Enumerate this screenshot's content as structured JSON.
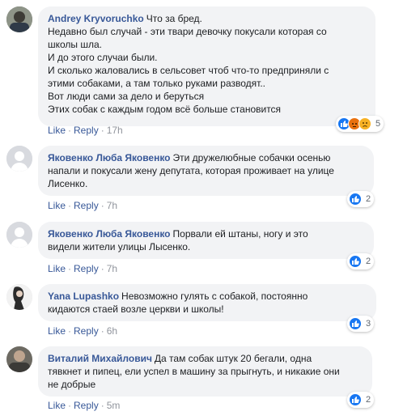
{
  "comments": [
    {
      "author": "Andrey Kryvoruchko",
      "lines": [
        "Что за бред.",
        "Недавно был случай - эти твари девочку покусали которая со",
        "школы шла.",
        "И до этого случаи были.",
        "И сколько жаловались в сельсовет чтоб что-то предприняли с",
        "этими собаками, а там только руками разводят..",
        "Вот люди сами за дело и беруться",
        "Этих собак с каждым годом всё больше становится"
      ],
      "like": "Like",
      "reply": "Reply",
      "time": "17h",
      "reactions": [
        "like-icon",
        "angry-icon",
        "sad-icon"
      ],
      "reaction_count": "5"
    },
    {
      "author": "Яковенко Люба Яковенко",
      "lines": [
        "Эти дружелюбные собачки осенью",
        "напали и покусали жену депутата, которая проживает на улице",
        "Лисенко."
      ],
      "like": "Like",
      "reply": "Reply",
      "time": "7h",
      "reactions": [
        "like-icon"
      ],
      "reaction_count": "2"
    },
    {
      "author": "Яковенко Люба Яковенко",
      "lines": [
        "Порвали ей штаны, ногу и это",
        "видели жители улицы Лысенко."
      ],
      "like": "Like",
      "reply": "Reply",
      "time": "7h",
      "reactions": [
        "like-icon"
      ],
      "reaction_count": "2"
    },
    {
      "author": "Yana Lupashko",
      "lines": [
        "Невозможно гулять с собакой, постоянно",
        "кидаются стаей возле церкви и школы!"
      ],
      "like": "Like",
      "reply": "Reply",
      "time": "6h",
      "reactions": [
        "like-icon"
      ],
      "reaction_count": "3"
    },
    {
      "author": "Виталий Михайлович",
      "lines": [
        "Да там собак штук 20 бегали, одна",
        "тявкнет и пипец, ели успел в машину за прыгнуть, и никакие они",
        "не добрые"
      ],
      "like": "Like",
      "reply": "Reply",
      "time": "5m",
      "reactions": [
        "like-icon"
      ],
      "reaction_count": "2"
    }
  ],
  "separator": "·",
  "colors": {
    "link": "#385898",
    "bubble": "#f2f3f5",
    "like": "#1877f2",
    "muted": "#90949c"
  }
}
